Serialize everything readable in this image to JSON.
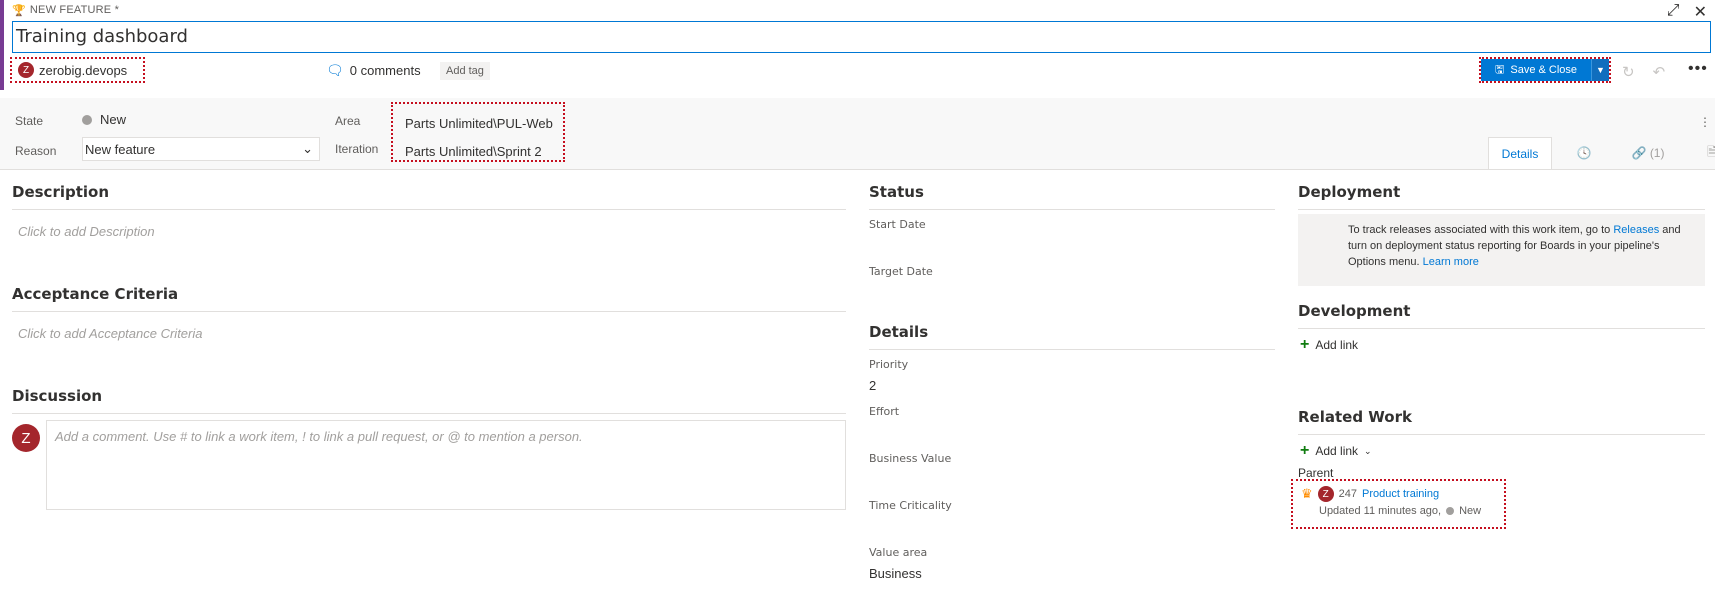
{
  "header": {
    "type_label": "NEW FEATURE *",
    "title": "Training dashboard",
    "user_name": "zerobig.devops",
    "user_initial": "Z",
    "comments_label": "0 comments",
    "add_tag_label": "Add tag",
    "save_close_label": "Save & Close"
  },
  "fields": {
    "state_label": "State",
    "state_value": "New",
    "reason_label": "Reason",
    "reason_value": "New feature",
    "area_label": "Area",
    "area_value": "Parts Unlimited\\PUL-Web",
    "iteration_label": "Iteration",
    "iteration_value": "Parts Unlimited\\Sprint 2"
  },
  "tabs": {
    "details_label": "Details",
    "links_label": "(1)"
  },
  "left": {
    "description_title": "Description",
    "description_placeholder": "Click to add Description",
    "acceptance_title": "Acceptance Criteria",
    "acceptance_placeholder": "Click to add Acceptance Criteria",
    "discussion_title": "Discussion",
    "comment_placeholder": "Add a comment. Use # to link a work item, ! to link a pull request, or @ to mention a person."
  },
  "middle": {
    "status_title": "Status",
    "start_date_label": "Start Date",
    "target_date_label": "Target Date",
    "details_title": "Details",
    "priority_label": "Priority",
    "priority_value": "2",
    "effort_label": "Effort",
    "business_value_label": "Business Value",
    "time_criticality_label": "Time Criticality",
    "value_area_label": "Value area",
    "value_area_value": "Business"
  },
  "right": {
    "deployment_title": "Deployment",
    "deployment_text_1": "To track releases associated with this work item, go to",
    "deployment_link_releases": "Releases",
    "deployment_text_2": "and turn on deployment status reporting for Boards in your pipeline's Options menu.",
    "deployment_link_learn": "Learn more",
    "development_title": "Development",
    "dev_add_link": "Add link",
    "related_title": "Related Work",
    "related_add_link": "Add link",
    "parent_label": "Parent",
    "parent_id": "247",
    "parent_title": "Product training",
    "parent_updated": "Updated 11 minutes ago,",
    "parent_state": "New"
  },
  "colors": {
    "accent": "#773b93",
    "primary": "#0078d4",
    "avatar": "#a4262c",
    "annotation": "#c50f1f"
  }
}
